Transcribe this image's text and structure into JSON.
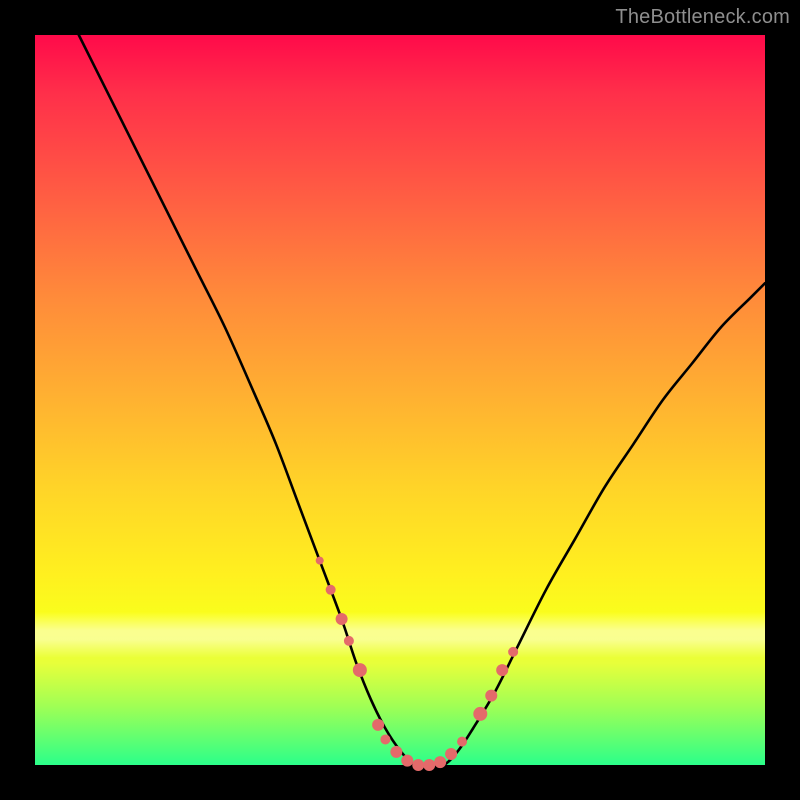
{
  "watermark": "TheBottleneck.com",
  "chart_data": {
    "type": "line",
    "title": "",
    "xlabel": "",
    "ylabel": "",
    "xlim": [
      0,
      100
    ],
    "ylim": [
      0,
      100
    ],
    "grid": false,
    "series": [
      {
        "name": "bottleneck-curve",
        "x": [
          6,
          10,
          14,
          18,
          22,
          26,
          30,
          33,
          36,
          39,
          42,
          44,
          46,
          48,
          50,
          52,
          54,
          56,
          58,
          60,
          63,
          66,
          70,
          74,
          78,
          82,
          86,
          90,
          94,
          98,
          100
        ],
        "y": [
          100,
          92,
          84,
          76,
          68,
          60,
          51,
          44,
          36,
          28,
          20,
          14,
          9,
          5,
          2,
          0,
          0,
          0,
          2,
          5,
          10,
          16,
          24,
          31,
          38,
          44,
          50,
          55,
          60,
          64,
          66
        ]
      }
    ],
    "markers": {
      "name": "highlight-dots",
      "color": "#e46a6a",
      "x": [
        39,
        40.5,
        42,
        43,
        44.5,
        47,
        48,
        49.5,
        51,
        52.5,
        54,
        55.5,
        57,
        58.5,
        61,
        62.5,
        64,
        65.5
      ],
      "y": [
        28,
        24,
        20,
        17,
        13,
        5.5,
        3.5,
        1.8,
        0.6,
        0,
        0,
        0.4,
        1.5,
        3.2,
        7,
        9.5,
        13,
        15.5
      ],
      "r": [
        4,
        5,
        6,
        5,
        7,
        6,
        5,
        6,
        6,
        6,
        6,
        6,
        6,
        5,
        7,
        6,
        6,
        5
      ]
    }
  }
}
